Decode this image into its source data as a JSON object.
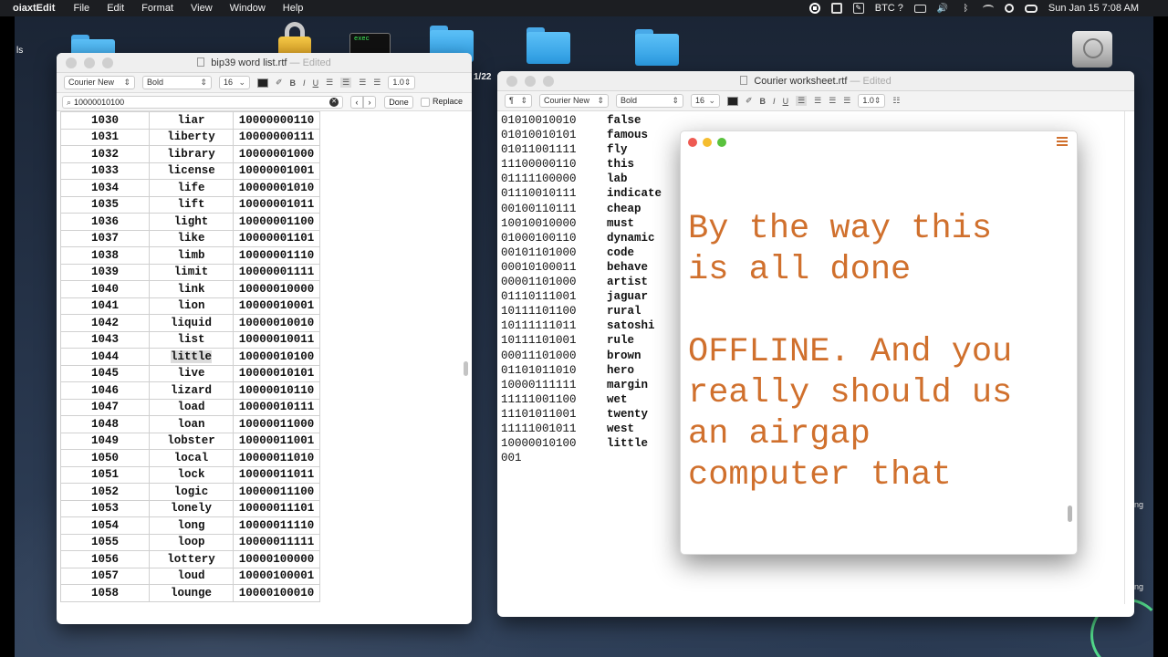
{
  "menubar": {
    "app_name": "oiaxtEdit",
    "menus": [
      "File",
      "Edit",
      "Format",
      "View",
      "Window",
      "Help"
    ],
    "crypto": "BTC ?",
    "clock": "Sun Jan 15  7:08 AM"
  },
  "desktop": {
    "left_label": "ls",
    "terminal_label": "exec",
    "date_fragment": "1/22",
    "right_label_1": "ng",
    "right_label_2": "ng"
  },
  "word_list_window": {
    "title": "bip39 word list.rtf",
    "edited": "— Edited",
    "font": "Courier New",
    "style": "Bold",
    "size": "16",
    "line_spacing": "1.0",
    "search_value": "10000010100",
    "done_label": "Done",
    "replace_label": "Replace",
    "rows": [
      [
        "1030",
        "liar",
        "10000000110"
      ],
      [
        "1031",
        "liberty",
        "10000000111"
      ],
      [
        "1032",
        "library",
        "10000001000"
      ],
      [
        "1033",
        "license",
        "10000001001"
      ],
      [
        "1034",
        "life",
        "10000001010"
      ],
      [
        "1035",
        "lift",
        "10000001011"
      ],
      [
        "1036",
        "light",
        "10000001100"
      ],
      [
        "1037",
        "like",
        "10000001101"
      ],
      [
        "1038",
        "limb",
        "10000001110"
      ],
      [
        "1039",
        "limit",
        "10000001111"
      ],
      [
        "1040",
        "link",
        "10000010000"
      ],
      [
        "1041",
        "lion",
        "10000010001"
      ],
      [
        "1042",
        "liquid",
        "10000010010"
      ],
      [
        "1043",
        "list",
        "10000010011"
      ],
      [
        "1044",
        "little",
        "10000010100"
      ],
      [
        "1045",
        "live",
        "10000010101"
      ],
      [
        "1046",
        "lizard",
        "10000010110"
      ],
      [
        "1047",
        "load",
        "10000010111"
      ],
      [
        "1048",
        "loan",
        "10000011000"
      ],
      [
        "1049",
        "lobster",
        "10000011001"
      ],
      [
        "1050",
        "local",
        "10000011010"
      ],
      [
        "1051",
        "lock",
        "10000011011"
      ],
      [
        "1052",
        "logic",
        "10000011100"
      ],
      [
        "1053",
        "lonely",
        "10000011101"
      ],
      [
        "1054",
        "long",
        "10000011110"
      ],
      [
        "1055",
        "loop",
        "10000011111"
      ],
      [
        "1056",
        "lottery",
        "10000100000"
      ],
      [
        "1057",
        "loud",
        "10000100001"
      ],
      [
        "1058",
        "lounge",
        "10000100010"
      ]
    ]
  },
  "worksheet_window": {
    "title": "Courier worksheet.rtf",
    "edited": "— Edited",
    "paragraph_mark": "¶",
    "font": "Courier New",
    "style": "Bold",
    "size": "16",
    "line_spacing": "1.0",
    "lines": [
      [
        "01010010010",
        "false"
      ],
      [
        "01010010101",
        "famous"
      ],
      [
        "01011001111",
        "fly"
      ],
      [
        "11100000110",
        "this"
      ],
      [
        "01111100000",
        "lab"
      ],
      [
        "01110010111",
        "indicate"
      ],
      [
        "00100110111",
        "cheap"
      ],
      [
        "10010010000",
        "must"
      ],
      [
        "01000100110",
        "dynamic"
      ],
      [
        "00101101000",
        "code"
      ],
      [
        "00010100011",
        "behave"
      ],
      [
        "00001101000",
        "artist"
      ],
      [
        "01110111001",
        "jaguar"
      ],
      [
        "10111101100",
        "rural"
      ],
      [
        "10111111011",
        "satoshi"
      ],
      [
        "10111101001",
        "rule"
      ],
      [
        "00011101000",
        "brown"
      ],
      [
        "01101011010",
        "hero"
      ],
      [
        "10000111111",
        "margin"
      ],
      [
        "11111001100",
        "wet"
      ],
      [
        "11101011001",
        "twenty"
      ],
      [
        "11111001011",
        "west"
      ],
      [
        "10000010100",
        "little"
      ],
      [
        "001",
        ""
      ]
    ]
  },
  "note": {
    "lines": [
      "By the way this",
      "is all done",
      "",
      "OFFLINE. And you",
      "really should us",
      "an airgap",
      "computer that"
    ]
  }
}
